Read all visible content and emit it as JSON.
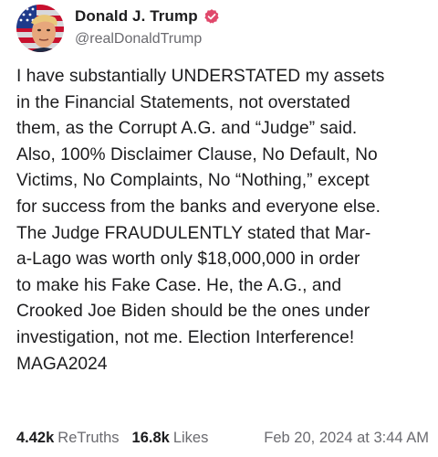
{
  "author": {
    "display_name": "Donald J. Trump",
    "handle": "@realDonaldTrump",
    "verified_color": "#e0486b"
  },
  "post": {
    "text": "I have substantially UNDERSTATED my assets\nin the Financial Statements, not overstated\nthem, as the Corrupt A.G. and “Judge” said.\nAlso, 100% Disclaimer Clause, No Default, No\nVictims, No Complaints, No “Nothing,” except\nfor success from the banks and everyone else.\nThe Judge FRAUDULENTLY stated that Mar-\na-Lago was worth only $18,000,000 in order\nto make his Fake Case. He, the A.G., and\nCrooked Joe Biden should be the ones under\ninvestigation, not me. Election Interference!\nMAGA2024"
  },
  "stats": {
    "retruths_count": "4.42k",
    "retruths_label": "ReTruths",
    "likes_count": "16.8k",
    "likes_label": "Likes",
    "timestamp": "Feb 20, 2024 at 3:44 AM"
  }
}
